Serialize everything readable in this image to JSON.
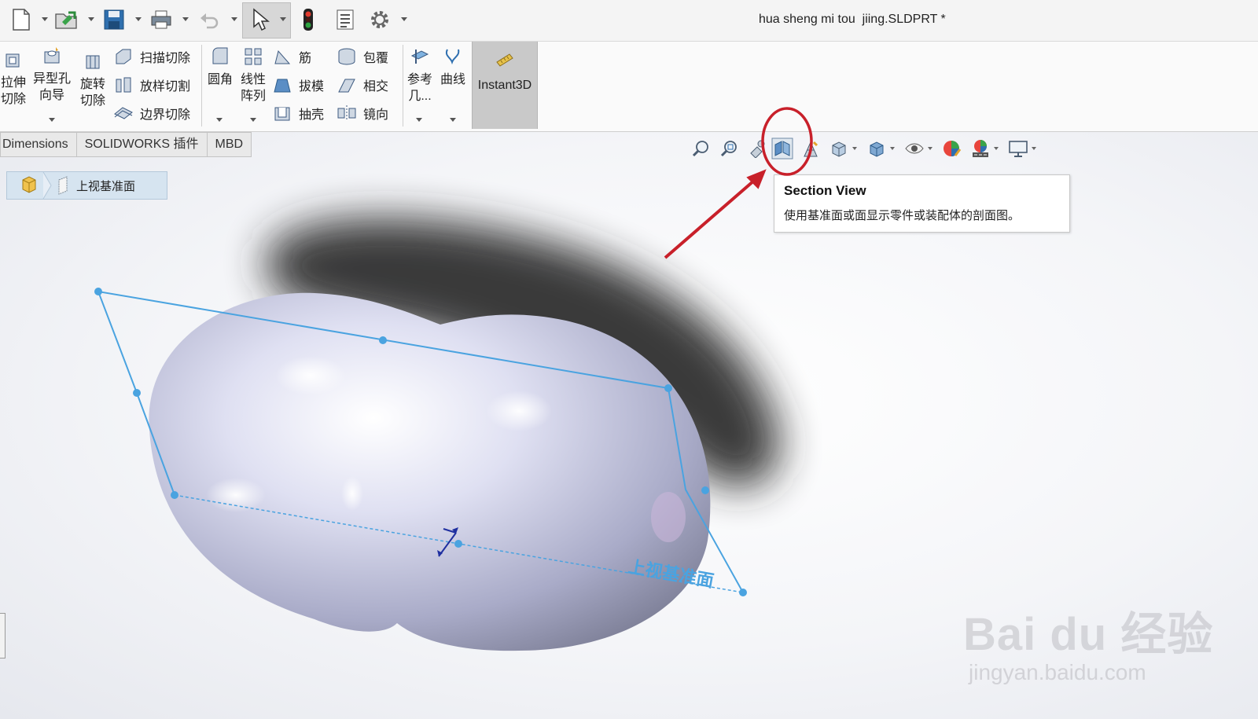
{
  "window": {
    "title": "hua sheng mi tou  jiing.SLDPRT *"
  },
  "top_toolbar": {
    "icons": [
      "new-file-icon",
      "open-file-icon",
      "save-icon",
      "print-icon",
      "undo-icon",
      "select-cursor-icon",
      "rebuild-traffic-light-icon",
      "file-properties-icon",
      "options-gear-icon"
    ]
  },
  "ribbon": {
    "extrude_cut": [
      "拉伸",
      "切除"
    ],
    "hole_wizard": [
      "异型孔",
      "向导"
    ],
    "revolve_cut": [
      "旋转",
      "切除"
    ],
    "sweep_cut": "扫描切除",
    "loft_cut": "放样切割",
    "boundary_cut": "边界切除",
    "fillet": "圆角",
    "linear_pattern": [
      "线性",
      "阵列"
    ],
    "rib": "筋",
    "wrap": "包覆",
    "draft": "拔模",
    "intersect": "相交",
    "shell": "抽壳",
    "mirror": "镜向",
    "reference_geometry": [
      "参考",
      "几..."
    ],
    "curves": "曲线",
    "instant3d": "Instant3D"
  },
  "tabs": [
    "Dimensions",
    "SOLIDWORKS 插件",
    "MBD"
  ],
  "breadcrumb": {
    "label": "上视基准面"
  },
  "heads_up_toolbar": {
    "icons": [
      "zoom-to-fit-icon",
      "zoom-to-area-icon",
      "previous-view-icon",
      "section-view-icon",
      "dynamic-annotation-views-icon",
      "view-orientation-icon",
      "display-style-icon",
      "hide-show-items-icon",
      "edit-appearance-icon",
      "apply-scene-icon",
      "view-settings-icon"
    ]
  },
  "tooltip": {
    "title": "Section View",
    "description": "使用基准面或面显示零件或装配体的剖面图。"
  },
  "viewport": {
    "plane_label": "上视基准面",
    "highlight_color": "#c8202a",
    "plane_color": "#4aa3e0",
    "model_color": "#c9cbe6"
  },
  "watermark": {
    "logo": "Bai du 经验",
    "url": "jingyan.baidu.com"
  }
}
